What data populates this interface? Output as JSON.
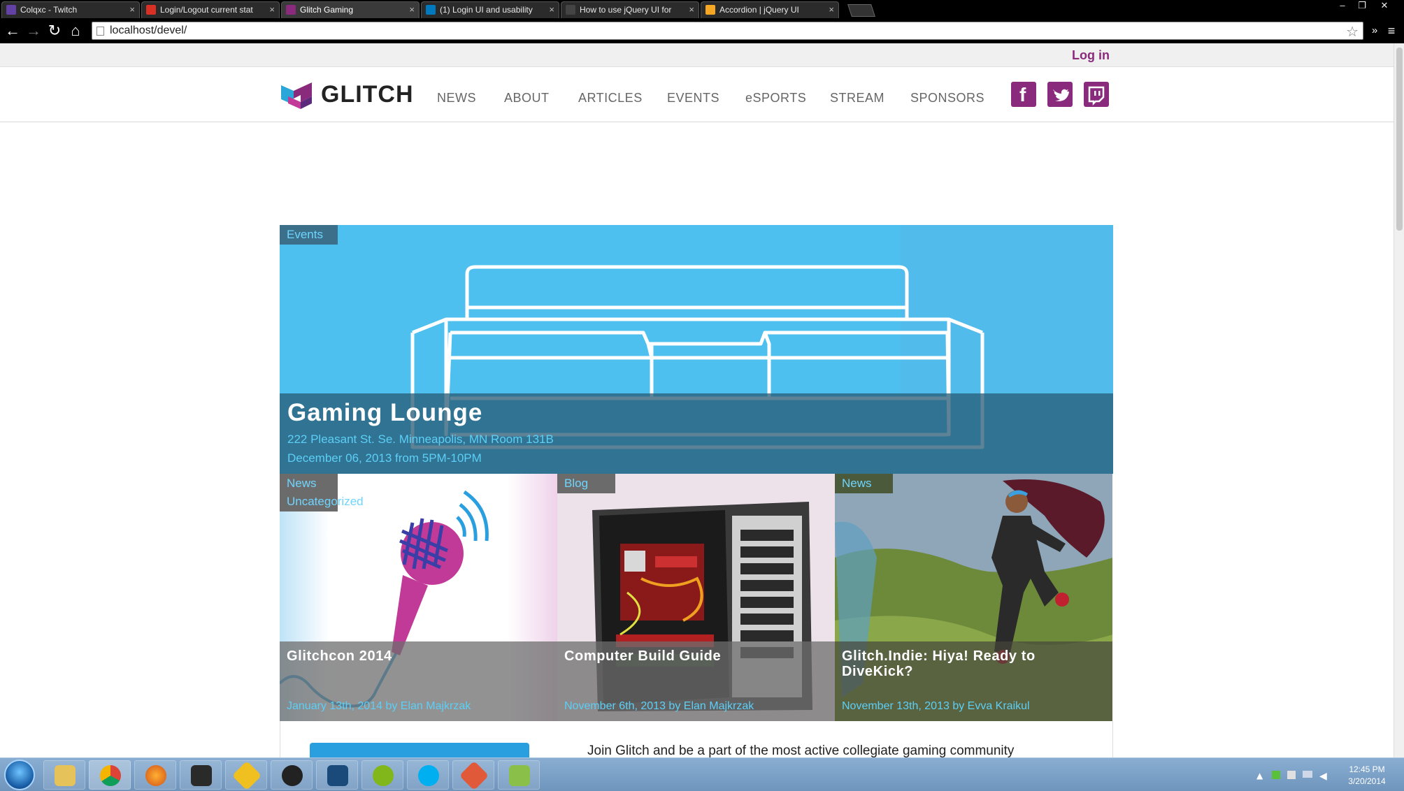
{
  "browser": {
    "tabs": [
      {
        "title": "Colqxc - Twitch",
        "icon": "twitch-icon",
        "color": "#6441a5",
        "active": false
      },
      {
        "title": "Login/Logout current stat",
        "icon": "gmail-icon",
        "color": "#d93025",
        "active": false
      },
      {
        "title": "Glitch Gaming",
        "icon": "glitch-icon",
        "color": "#8a2a7c",
        "active": true
      },
      {
        "title": "(1) Login UI and usability",
        "icon": "trello-icon",
        "color": "#0079bf",
        "active": false
      },
      {
        "title": "How to use jQuery UI for",
        "icon": "google-icon",
        "color": "#444444",
        "active": false
      },
      {
        "title": "Accordion | jQuery UI",
        "icon": "jquery-icon",
        "color": "#f5a623",
        "active": false
      }
    ],
    "url": "localhost/devel/"
  },
  "topbar": {
    "login_label": "Log in"
  },
  "header": {
    "logo_text": "GLITCH",
    "nav": [
      "NEWS",
      "ABOUT",
      "ARTICLES",
      "EVENTS",
      "eSPORTS",
      "STREAM",
      "SPONSORS"
    ],
    "social": [
      {
        "name": "facebook-icon",
        "glyph": "f"
      },
      {
        "name": "twitter-icon",
        "glyph": "t"
      },
      {
        "name": "twitch-icon",
        "glyph": "tv"
      }
    ]
  },
  "hero": {
    "category": "Events",
    "title": "Gaming Lounge",
    "address": "222 Pleasant St. Se. Minneapolis, MN Room 131B",
    "datetime": "December 06, 2013 from 5PM-10PM"
  },
  "cards": [
    {
      "category": "News",
      "subcategory": "Uncategorized",
      "title": "Glitchcon 2014",
      "meta": "January 13th, 2014 by Elan Majkrzak"
    },
    {
      "category": "Blog",
      "subcategory": "",
      "title": "Computer Build Guide",
      "meta": "November 6th, 2013 by Elan Majkrzak"
    },
    {
      "category": "News",
      "subcategory": "",
      "title": "Glitch.Indie: Hiya! Ready to DiveKick?",
      "meta": "November 13th, 2013 by Evva Kraikul"
    }
  ],
  "join": {
    "text": "Join Glitch and be a part of the most active collegiate gaming community"
  },
  "taskbar": {
    "apps": [
      "explorer-icon",
      "chrome-icon",
      "firefox-icon",
      "steam-icon",
      "winamp-icon",
      "media-icon",
      "league-icon",
      "spotify-icon",
      "skype-icon",
      "git-icon",
      "notepad-icon"
    ],
    "time": "12:45 PM",
    "date": "3/20/2014"
  },
  "colors": {
    "accent": "#8a2a7c",
    "hero_blue": "#4dc0ef",
    "meta_blue": "#5ccff7"
  }
}
